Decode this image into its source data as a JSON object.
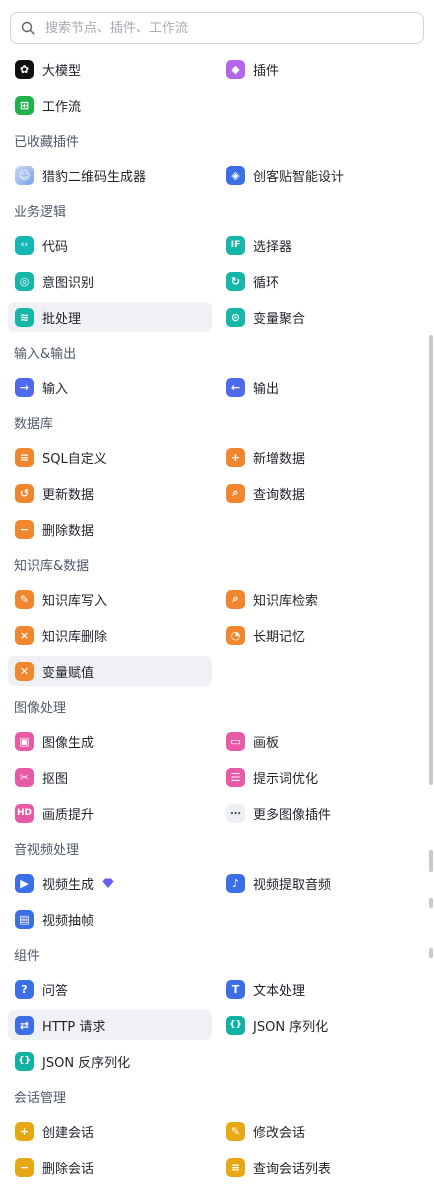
{
  "search": {
    "placeholder": "搜索节点、插件、工作流"
  },
  "top_items": [
    {
      "label": "大模型",
      "icon": "llm-icon"
    },
    {
      "label": "插件",
      "icon": "plugin-icon"
    },
    {
      "label": "工作流",
      "icon": "workflow-icon"
    }
  ],
  "sections": [
    {
      "title": "已收藏插件",
      "items": [
        {
          "label": "猎豹二维码生成器",
          "icon": "qr-generator-avatar-icon"
        },
        {
          "label": "创客贴智能设计",
          "icon": "design-icon"
        }
      ]
    },
    {
      "title": "业务逻辑",
      "items": [
        {
          "label": "代码",
          "icon": "code-icon"
        },
        {
          "label": "选择器",
          "icon": "condition-if-icon"
        },
        {
          "label": "意图识别",
          "icon": "intent-icon"
        },
        {
          "label": "循环",
          "icon": "loop-icon"
        },
        {
          "label": "批处理",
          "icon": "batch-icon",
          "highlighted": true
        },
        {
          "label": "变量聚合",
          "icon": "variable-merge-icon"
        }
      ]
    },
    {
      "title": "输入&输出",
      "items": [
        {
          "label": "输入",
          "icon": "input-icon"
        },
        {
          "label": "输出",
          "icon": "output-icon"
        }
      ]
    },
    {
      "title": "数据库",
      "items": [
        {
          "label": "SQL自定义",
          "icon": "sql-icon"
        },
        {
          "label": "新增数据",
          "icon": "add-data-icon"
        },
        {
          "label": "更新数据",
          "icon": "update-data-icon"
        },
        {
          "label": "查询数据",
          "icon": "query-data-icon"
        },
        {
          "label": "删除数据",
          "icon": "delete-data-icon"
        }
      ]
    },
    {
      "title": "知识库&数据",
      "items": [
        {
          "label": "知识库写入",
          "icon": "kb-write-icon"
        },
        {
          "label": "知识库检索",
          "icon": "kb-search-icon"
        },
        {
          "label": "知识库删除",
          "icon": "kb-delete-icon"
        },
        {
          "label": "长期记忆",
          "icon": "memory-icon"
        },
        {
          "label": "变量赋值",
          "icon": "variable-assign-icon",
          "highlighted": true
        }
      ]
    },
    {
      "title": "图像处理",
      "items": [
        {
          "label": "图像生成",
          "icon": "image-gen-icon"
        },
        {
          "label": "画板",
          "icon": "canvas-icon"
        },
        {
          "label": "抠图",
          "icon": "cutout-icon"
        },
        {
          "label": "提示词优化",
          "icon": "prompt-optimize-icon"
        },
        {
          "label": "画质提升",
          "icon": "quality-enhance-icon"
        },
        {
          "label": "更多图像插件",
          "icon": "more-icon"
        }
      ]
    },
    {
      "title": "音视频处理",
      "items": [
        {
          "label": "视频生成",
          "icon": "video-gen-icon",
          "badge": "diamond-icon"
        },
        {
          "label": "视频提取音频",
          "icon": "video-audio-icon"
        },
        {
          "label": "视频抽帧",
          "icon": "video-frame-icon"
        }
      ]
    },
    {
      "title": "组件",
      "items": [
        {
          "label": "问答",
          "icon": "question-icon"
        },
        {
          "label": "文本处理",
          "icon": "text-process-icon"
        },
        {
          "label": "HTTP 请求",
          "icon": "http-icon",
          "highlighted": true
        },
        {
          "label": "JSON 序列化",
          "icon": "json-serialize-icon"
        },
        {
          "label": "JSON 反序列化",
          "icon": "json-deserialize-icon"
        }
      ]
    },
    {
      "title": "会话管理",
      "items": [
        {
          "label": "创建会话",
          "icon": "create-chat-icon"
        },
        {
          "label": "修改会话",
          "icon": "edit-chat-icon"
        },
        {
          "label": "删除会话",
          "icon": "delete-chat-icon"
        },
        {
          "label": "查询会话列表",
          "icon": "list-chat-icon"
        }
      ]
    }
  ]
}
